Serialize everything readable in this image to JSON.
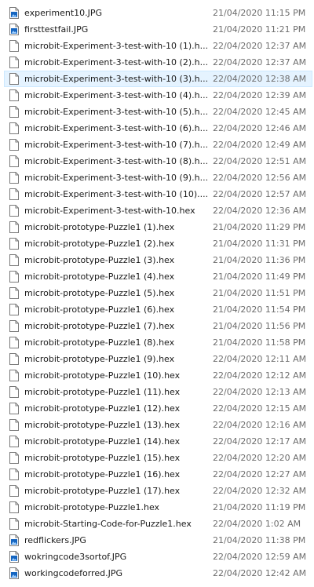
{
  "files": [
    {
      "name": "experiment10.JPG",
      "modified": "21/04/2020 11:15 PM",
      "type": "image"
    },
    {
      "name": "firsttestfail.JPG",
      "modified": "21/04/2020 11:21 PM",
      "type": "image"
    },
    {
      "name": "microbit-Experiment-3-test-with-10 (1).h...",
      "modified": "22/04/2020 12:37 AM",
      "type": "document"
    },
    {
      "name": "microbit-Experiment-3-test-with-10 (2).h...",
      "modified": "22/04/2020 12:37 AM",
      "type": "document"
    },
    {
      "name": "microbit-Experiment-3-test-with-10 (3).h...",
      "modified": "22/04/2020 12:38 AM",
      "type": "document",
      "selected": true
    },
    {
      "name": "microbit-Experiment-3-test-with-10 (4).h...",
      "modified": "22/04/2020 12:39 AM",
      "type": "document"
    },
    {
      "name": "microbit-Experiment-3-test-with-10 (5).h...",
      "modified": "22/04/2020 12:45 AM",
      "type": "document"
    },
    {
      "name": "microbit-Experiment-3-test-with-10 (6).h...",
      "modified": "22/04/2020 12:46 AM",
      "type": "document"
    },
    {
      "name": "microbit-Experiment-3-test-with-10 (7).h...",
      "modified": "22/04/2020 12:49 AM",
      "type": "document"
    },
    {
      "name": "microbit-Experiment-3-test-with-10 (8).h...",
      "modified": "22/04/2020 12:51 AM",
      "type": "document"
    },
    {
      "name": "microbit-Experiment-3-test-with-10 (9).h...",
      "modified": "22/04/2020 12:56 AM",
      "type": "document"
    },
    {
      "name": "microbit-Experiment-3-test-with-10 (10)....",
      "modified": "22/04/2020 12:57 AM",
      "type": "document"
    },
    {
      "name": "microbit-Experiment-3-test-with-10.hex",
      "modified": "22/04/2020 12:36 AM",
      "type": "document"
    },
    {
      "name": "microbit-prototype-Puzzle1 (1).hex",
      "modified": "21/04/2020 11:29 PM",
      "type": "document"
    },
    {
      "name": "microbit-prototype-Puzzle1 (2).hex",
      "modified": "21/04/2020 11:31 PM",
      "type": "document"
    },
    {
      "name": "microbit-prototype-Puzzle1 (3).hex",
      "modified": "21/04/2020 11:36 PM",
      "type": "document"
    },
    {
      "name": "microbit-prototype-Puzzle1 (4).hex",
      "modified": "21/04/2020 11:49 PM",
      "type": "document"
    },
    {
      "name": "microbit-prototype-Puzzle1 (5).hex",
      "modified": "21/04/2020 11:51 PM",
      "type": "document"
    },
    {
      "name": "microbit-prototype-Puzzle1 (6).hex",
      "modified": "21/04/2020 11:54 PM",
      "type": "document"
    },
    {
      "name": "microbit-prototype-Puzzle1 (7).hex",
      "modified": "21/04/2020 11:56 PM",
      "type": "document"
    },
    {
      "name": "microbit-prototype-Puzzle1 (8).hex",
      "modified": "21/04/2020 11:58 PM",
      "type": "document"
    },
    {
      "name": "microbit-prototype-Puzzle1 (9).hex",
      "modified": "22/04/2020 12:11 AM",
      "type": "document"
    },
    {
      "name": "microbit-prototype-Puzzle1 (10).hex",
      "modified": "22/04/2020 12:12 AM",
      "type": "document"
    },
    {
      "name": "microbit-prototype-Puzzle1 (11).hex",
      "modified": "22/04/2020 12:13 AM",
      "type": "document"
    },
    {
      "name": "microbit-prototype-Puzzle1 (12).hex",
      "modified": "22/04/2020 12:15 AM",
      "type": "document"
    },
    {
      "name": "microbit-prototype-Puzzle1 (13).hex",
      "modified": "22/04/2020 12:16 AM",
      "type": "document"
    },
    {
      "name": "microbit-prototype-Puzzle1 (14).hex",
      "modified": "22/04/2020 12:17 AM",
      "type": "document"
    },
    {
      "name": "microbit-prototype-Puzzle1 (15).hex",
      "modified": "22/04/2020 12:20 AM",
      "type": "document"
    },
    {
      "name": "microbit-prototype-Puzzle1 (16).hex",
      "modified": "22/04/2020 12:27 AM",
      "type": "document"
    },
    {
      "name": "microbit-prototype-Puzzle1 (17).hex",
      "modified": "22/04/2020 12:32 AM",
      "type": "document"
    },
    {
      "name": "microbit-prototype-Puzzle1.hex",
      "modified": "21/04/2020 11:19 PM",
      "type": "document"
    },
    {
      "name": "microbit-Starting-Code-for-Puzzle1.hex",
      "modified": "22/04/2020 1:02 AM",
      "type": "document"
    },
    {
      "name": "redflickers.JPG",
      "modified": "21/04/2020 11:38 PM",
      "type": "image"
    },
    {
      "name": "wokringcode3sortof.JPG",
      "modified": "22/04/2020 12:59 AM",
      "type": "image"
    },
    {
      "name": "workingcodeforred.JPG",
      "modified": "22/04/2020 12:42 AM",
      "type": "image"
    }
  ],
  "colors": {
    "selection_background": "#e5f3ff",
    "selection_border": "#cce8ff",
    "date_text": "#6d6d6d",
    "name_text": "#1a1a1a",
    "image_icon_accent": "#1565c0"
  },
  "icons": {
    "image": "image-file-icon",
    "document": "document-file-icon"
  }
}
